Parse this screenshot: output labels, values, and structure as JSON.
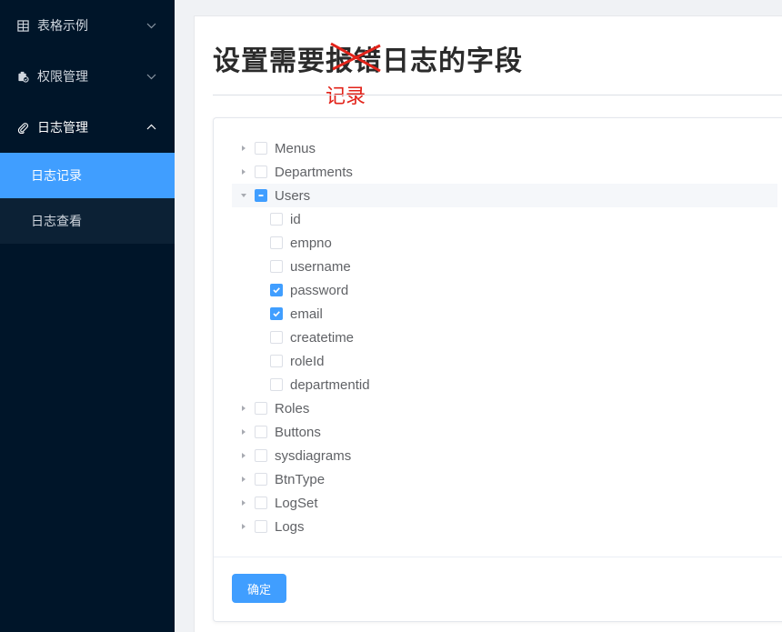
{
  "sidebar": {
    "items": [
      {
        "label": "表格示例",
        "icon": "table-icon",
        "expanded": false
      },
      {
        "label": "权限管理",
        "icon": "permission-icon",
        "expanded": false
      },
      {
        "label": "日志管理",
        "icon": "paperclip-icon",
        "expanded": true,
        "children": [
          {
            "label": "日志记录",
            "active": true
          },
          {
            "label": "日志查看",
            "active": false
          }
        ]
      }
    ]
  },
  "page": {
    "title": "设置需要报错日志的字段",
    "annotation": "记录",
    "annotation_color": "#e2231a"
  },
  "tree": {
    "nodes": [
      {
        "label": "Menus",
        "state": "unchecked",
        "expanded": false
      },
      {
        "label": "Departments",
        "state": "unchecked",
        "expanded": false
      },
      {
        "label": "Users",
        "state": "indeterminate",
        "expanded": true,
        "children": [
          {
            "label": "id",
            "state": "unchecked"
          },
          {
            "label": "empno",
            "state": "unchecked"
          },
          {
            "label": "username",
            "state": "unchecked"
          },
          {
            "label": "password",
            "state": "checked"
          },
          {
            "label": "email",
            "state": "checked"
          },
          {
            "label": "createtime",
            "state": "unchecked"
          },
          {
            "label": "roleId",
            "state": "unchecked"
          },
          {
            "label": "departmentid",
            "state": "unchecked"
          }
        ]
      },
      {
        "label": "Roles",
        "state": "unchecked",
        "expanded": false
      },
      {
        "label": "Buttons",
        "state": "unchecked",
        "expanded": false
      },
      {
        "label": "sysdiagrams",
        "state": "unchecked",
        "expanded": false
      },
      {
        "label": "BtnType",
        "state": "unchecked",
        "expanded": false
      },
      {
        "label": "LogSet",
        "state": "unchecked",
        "expanded": false
      },
      {
        "label": "Logs",
        "state": "unchecked",
        "expanded": false
      }
    ]
  },
  "actions": {
    "confirm_label": "确定"
  },
  "colors": {
    "sidebar_bg": "#001529",
    "accent": "#409eff"
  }
}
